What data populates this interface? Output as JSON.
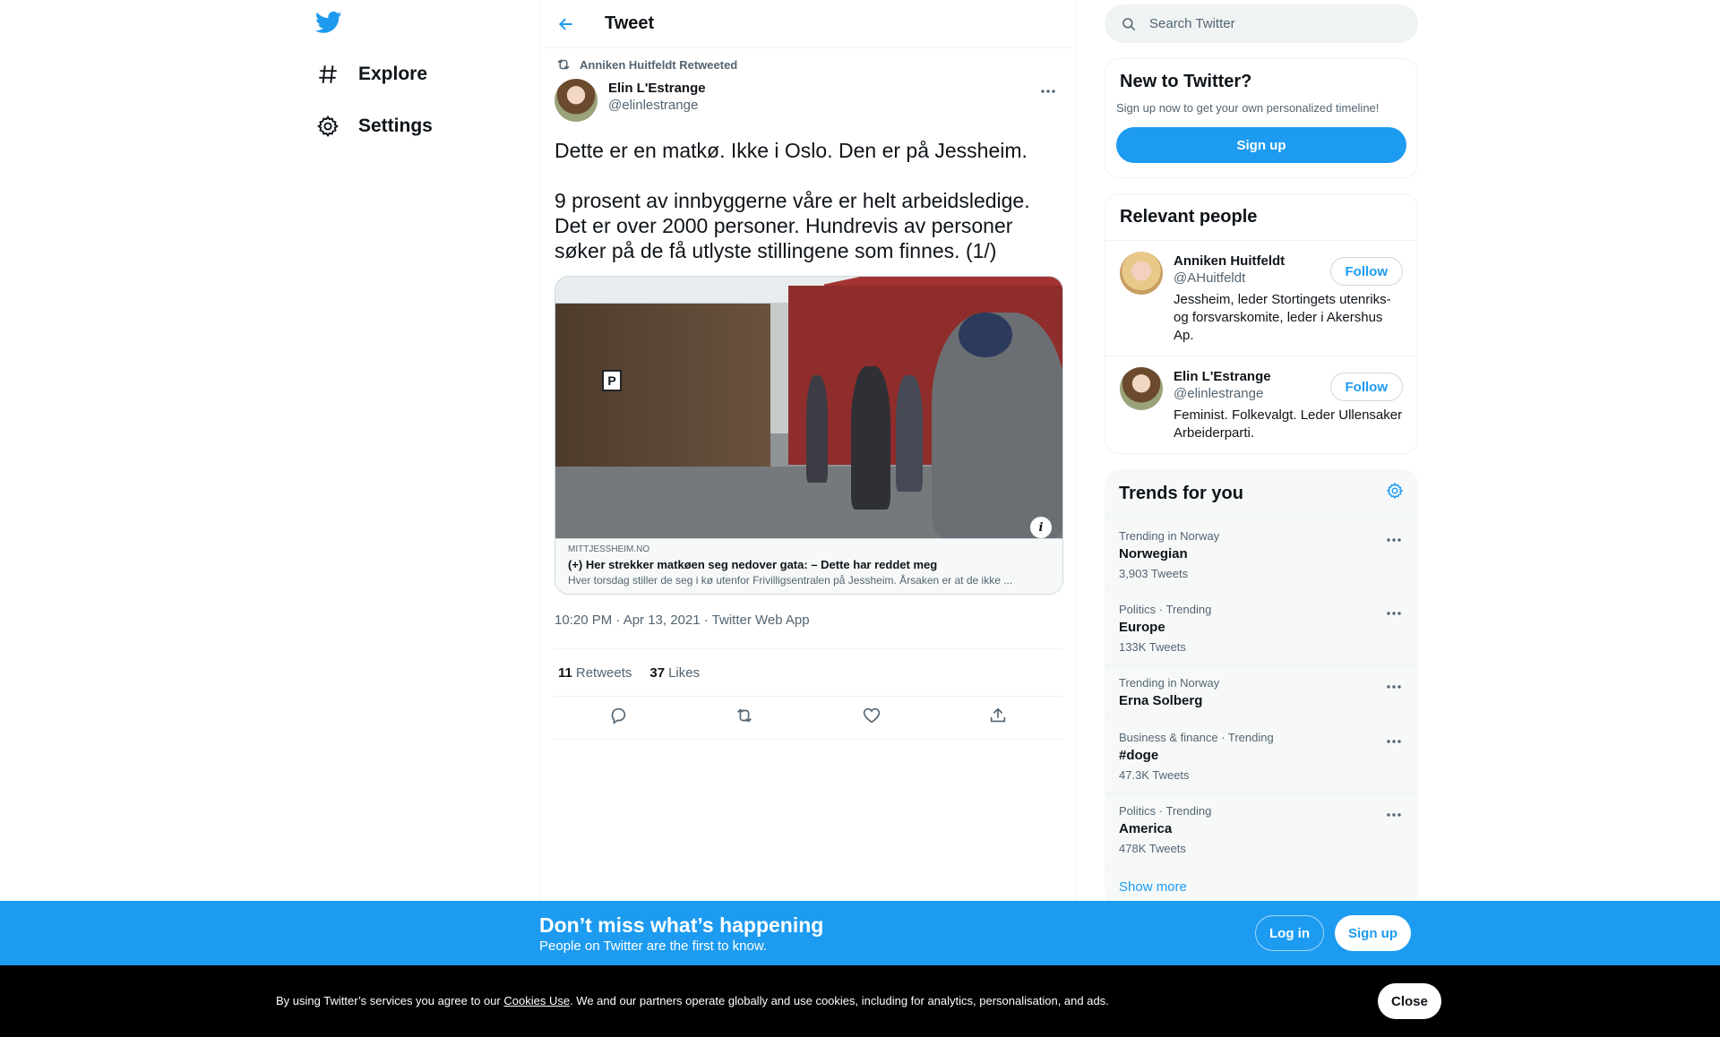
{
  "nav": {
    "explore_label": "Explore",
    "settings_label": "Settings"
  },
  "header": {
    "title": "Tweet"
  },
  "tweet": {
    "retweeted_by": "Anniken Huitfeldt Retweeted",
    "author_name": "Elin L'Estrange",
    "author_handle": "@elinlestrange",
    "text": "Dette er en matkø. Ikke i Oslo. Den er på Jessheim.\n\n9 prosent av innbyggerne våre er helt arbeidsledige. Det er over 2000 personer. Hundrevis av personer søker på de få utlyste stillingene som finnes. (1/)",
    "card": {
      "domain": "MITTJESSHEIM.NO",
      "title": "(+) Her strekker matkøen seg nedover gata: – Dette har reddet meg",
      "description": "Hver torsdag stiller de seg i kø utenfor Frivilligsentralen på Jessheim. Årsaken er at de ikke ..."
    },
    "timestamp": "10:20 PM · Apr 13, 2021 · Twitter Web App",
    "retweets_count": "11",
    "retweets_label": "Retweets",
    "likes_count": "37",
    "likes_label": "Likes"
  },
  "search": {
    "placeholder": "Search Twitter"
  },
  "new_to_twitter": {
    "title": "New to Twitter?",
    "subtitle": "Sign up now to get your own personalized timeline!",
    "signup_label": "Sign up"
  },
  "relevant_people": {
    "title": "Relevant people",
    "people": [
      {
        "name": "Anniken Huitfeldt",
        "handle": "@AHuitfeldt",
        "bio": "Jessheim, leder Stortingets utenriks- og forsvarskomite, leder i Akershus Ap.",
        "follow_label": "Follow"
      },
      {
        "name": "Elin L'Estrange",
        "handle": "@elinlestrange",
        "bio": "Feminist. Folkevalgt. Leder Ullensaker Arbeiderparti.",
        "follow_label": "Follow"
      }
    ]
  },
  "trends": {
    "title": "Trends for you",
    "items": [
      {
        "context": "Trending in Norway",
        "name": "Norwegian",
        "count": "3,903 Tweets"
      },
      {
        "context": "Politics · Trending",
        "name": "Europe",
        "count": "133K Tweets"
      },
      {
        "context": "Trending in Norway",
        "name": "Erna Solberg",
        "count": ""
      },
      {
        "context": "Business & finance · Trending",
        "name": "#doge",
        "count": "47.3K Tweets"
      },
      {
        "context": "Politics · Trending",
        "name": "America",
        "count": "478K Tweets"
      }
    ],
    "show_more_label": "Show more"
  },
  "banner": {
    "title": "Don’t miss what’s happening",
    "subtitle": "People on Twitter are the first to know.",
    "login_label": "Log in",
    "signup_label": "Sign up"
  },
  "cookie": {
    "text_before": "By using Twitter’s services you agree to our ",
    "link_label": "Cookies Use",
    "text_after": ". We and our partners operate globally and use cookies, including for analytics, personalisation, and ads.",
    "close_label": "Close"
  },
  "colors": {
    "accent": "#1d9bf0",
    "text_secondary": "#536471",
    "border": "#eff3f4",
    "cookie_bg": "#000000"
  }
}
